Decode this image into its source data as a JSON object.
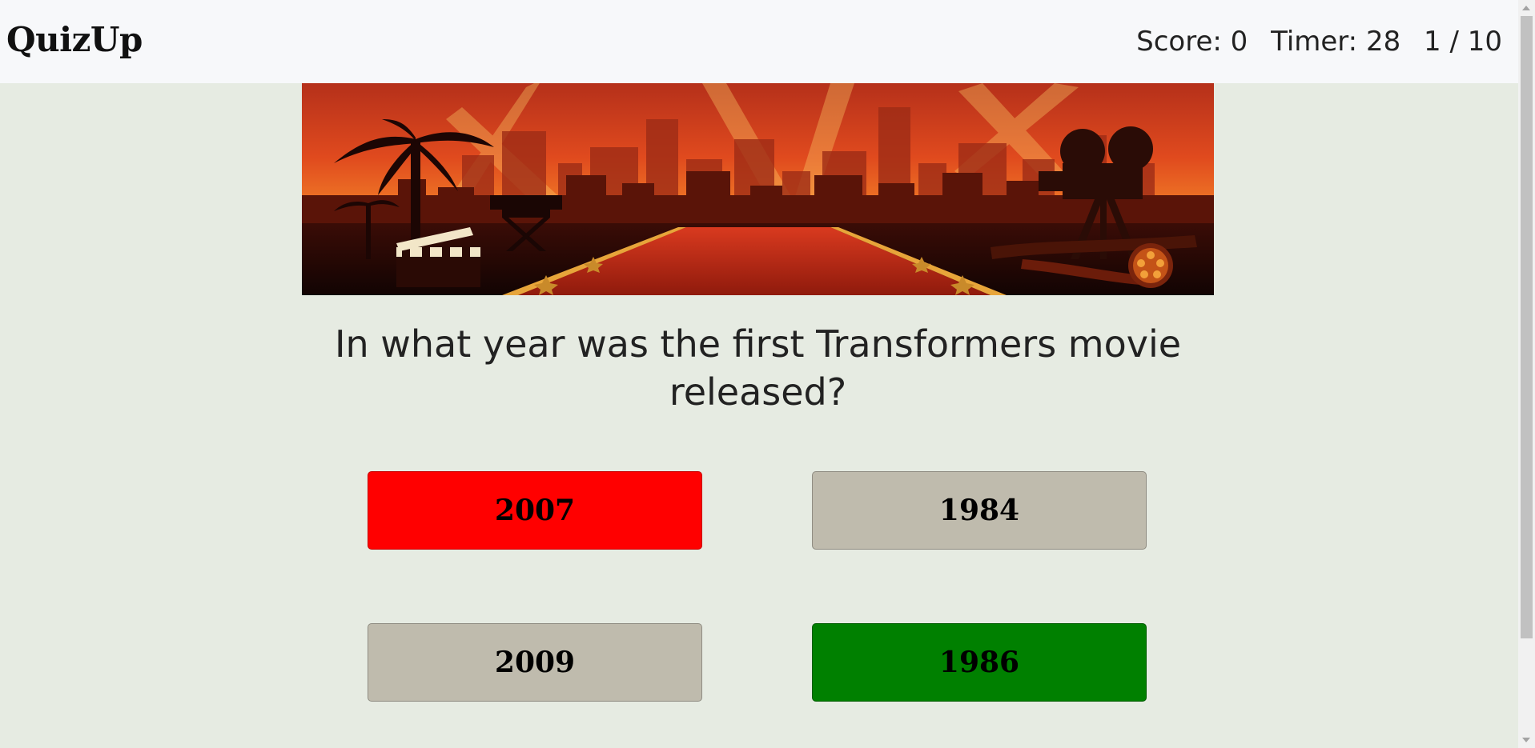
{
  "app": {
    "brand": "QuizUp"
  },
  "stats": {
    "score": "Score: 0",
    "timer": "Timer: 28",
    "progress": "1 / 10"
  },
  "banner": {
    "icon": "hollywood-red-carpet-illustration"
  },
  "question": {
    "text": "In what year was the first Transformers movie released?"
  },
  "answers": [
    {
      "label": "2007",
      "state": "incorrect-selected",
      "color": "#ff0000"
    },
    {
      "label": "1984",
      "state": "neutral",
      "color": "#bfbbad"
    },
    {
      "label": "2009",
      "state": "neutral",
      "color": "#bfbbad"
    },
    {
      "label": "1986",
      "state": "correct",
      "color": "#008000"
    }
  ],
  "colors": {
    "background": "#e6ebe2",
    "navbar": "#f7f8fa"
  }
}
